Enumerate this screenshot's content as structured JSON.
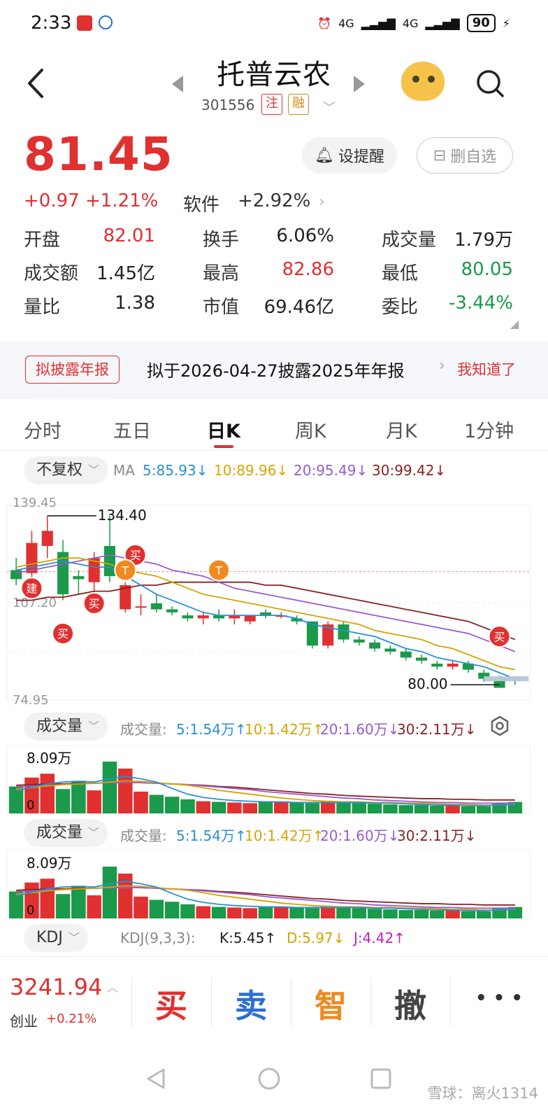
{
  "status": {
    "time": "2:33",
    "net1": "4G",
    "net2": "4G",
    "battery": "90"
  },
  "header": {
    "title": "托普云农",
    "code": "301556",
    "tag1": "注",
    "tag2": "融"
  },
  "quote": {
    "price": "81.45",
    "change": "+0.97",
    "change_pct": "+1.21%",
    "sector": "软件",
    "sector_pct": "+2.92%",
    "alert_btn": "设提醒",
    "del_btn": "删自选",
    "stats": [
      [
        {
          "label": "开盘",
          "value": "82.01",
          "tone": "red"
        },
        {
          "label": "换手",
          "value": "6.06%",
          "tone": "black"
        },
        {
          "label": "成交量",
          "value": "1.79万",
          "tone": "black"
        }
      ],
      [
        {
          "label": "成交额",
          "value": "1.45亿",
          "tone": "black"
        },
        {
          "label": "最高",
          "value": "82.86",
          "tone": "red"
        },
        {
          "label": "最低",
          "value": "80.05",
          "tone": "green"
        }
      ],
      [
        {
          "label": "量比",
          "value": "1.38",
          "tone": "black"
        },
        {
          "label": "市值",
          "value": "69.46亿",
          "tone": "black"
        },
        {
          "label": "委比",
          "value": "-3.44%",
          "tone": "green"
        }
      ]
    ]
  },
  "banner": {
    "badge": "拟披露年报",
    "text": "拟于2026-04-27披露2025年年报",
    "action": "我知道了"
  },
  "tabs": [
    "分时",
    "五日",
    "日K",
    "周K",
    "月K",
    "1分钟"
  ],
  "active_tab": "日K",
  "ma_row": {
    "pill": "不复权",
    "ma_label": "MA",
    "ma5": "5:85.93↓",
    "ma10": "10:89.96↓",
    "ma20": "20:95.49↓",
    "ma30": "30:99.42↓"
  },
  "vol_rows": [
    {
      "pill": "成交量",
      "label": "成交量:",
      "v5": "5:1.54万↑",
      "v10": "10:1.42万↑",
      "v20": "20:1.60万↓",
      "v30": "30:2.11万↓"
    },
    {
      "pill": "成交量",
      "label": "成交量:",
      "v5": "5:1.54万↑",
      "v10": "10:1.42万↑",
      "v20": "20:1.60万↓",
      "v30": "30:2.11万↓"
    }
  ],
  "kdj_row": {
    "pill": "KDJ",
    "label": "KDJ(9,3,3):",
    "k": "K:5.45↑",
    "d": "D:5.97↓",
    "j": "J:4.42↑"
  },
  "chart_data": {
    "type": "candlestick",
    "y_axis_labels": [
      "139.45",
      "107.20",
      "74.95"
    ],
    "high_marker": "134.40",
    "low_marker": "80.00",
    "volume_max_label": "8.09万",
    "volume_zero_label": "0",
    "signals": [
      "买",
      "建",
      "买",
      "买",
      "T",
      "T",
      "买"
    ],
    "candles": [
      {
        "o": 118,
        "h": 122,
        "l": 113,
        "c": 115
      },
      {
        "o": 117,
        "h": 131,
        "l": 112,
        "c": 127
      },
      {
        "o": 126,
        "h": 136,
        "l": 122,
        "c": 131
      },
      {
        "o": 124,
        "h": 128,
        "l": 108,
        "c": 110
      },
      {
        "o": 116,
        "h": 118,
        "l": 110,
        "c": 115
      },
      {
        "o": 114,
        "h": 124,
        "l": 108,
        "c": 122
      },
      {
        "o": 126,
        "h": 136,
        "l": 114,
        "c": 116
      },
      {
        "o": 105,
        "h": 114,
        "l": 104,
        "c": 113
      },
      {
        "o": 106,
        "h": 110,
        "l": 103,
        "c": 106
      },
      {
        "o": 107,
        "h": 110,
        "l": 104,
        "c": 105
      },
      {
        "o": 105,
        "h": 106,
        "l": 103,
        "c": 104
      },
      {
        "o": 103,
        "h": 104,
        "l": 101,
        "c": 102
      },
      {
        "o": 102,
        "h": 104,
        "l": 100,
        "c": 103
      },
      {
        "o": 103,
        "h": 105,
        "l": 101,
        "c": 102
      },
      {
        "o": 102,
        "h": 105,
        "l": 100,
        "c": 103
      },
      {
        "o": 101,
        "h": 103,
        "l": 100,
        "c": 103
      },
      {
        "o": 104,
        "h": 105,
        "l": 102,
        "c": 103
      },
      {
        "o": 103,
        "h": 104,
        "l": 102,
        "c": 103
      },
      {
        "o": 102,
        "h": 103,
        "l": 100,
        "c": 101
      },
      {
        "o": 101,
        "h": 101,
        "l": 92,
        "c": 93
      },
      {
        "o": 93,
        "h": 101,
        "l": 92,
        "c": 100
      },
      {
        "o": 100,
        "h": 101,
        "l": 94,
        "c": 95
      },
      {
        "o": 95,
        "h": 96,
        "l": 93,
        "c": 94
      },
      {
        "o": 94,
        "h": 95,
        "l": 91,
        "c": 92
      },
      {
        "o": 92,
        "h": 93,
        "l": 90,
        "c": 91
      },
      {
        "o": 91,
        "h": 92,
        "l": 88,
        "c": 89
      },
      {
        "o": 89,
        "h": 90,
        "l": 87,
        "c": 88
      },
      {
        "o": 87,
        "h": 88,
        "l": 85,
        "c": 86
      },
      {
        "o": 86,
        "h": 88,
        "l": 85,
        "c": 87
      },
      {
        "o": 87,
        "h": 88,
        "l": 84,
        "c": 85
      },
      {
        "o": 84,
        "h": 85,
        "l": 81,
        "c": 82
      },
      {
        "o": 82,
        "h": 83,
        "l": 79,
        "c": 79
      },
      {
        "o": 82,
        "h": 82.9,
        "l": 80,
        "c": 81.45
      }
    ],
    "ma5": [
      118,
      119,
      120,
      121,
      120,
      119,
      119,
      116,
      113,
      110,
      108,
      106,
      104,
      103,
      103,
      103,
      103,
      103,
      102,
      100,
      99,
      98,
      97,
      96,
      94,
      92,
      91,
      89,
      88,
      87,
      86,
      84,
      82
    ],
    "ma10": [
      119,
      120,
      121,
      122,
      122,
      121,
      120,
      118,
      117,
      116,
      114,
      112,
      110,
      109,
      108,
      107,
      106,
      105,
      104,
      103,
      102,
      101,
      100,
      98,
      97,
      96,
      95,
      93,
      92,
      90,
      88,
      86,
      85
    ],
    "ma20": [
      117,
      118,
      119,
      120,
      121,
      122,
      123,
      122,
      121,
      120,
      118,
      117,
      116,
      114,
      112,
      111,
      110,
      109,
      108,
      107,
      106,
      105,
      104,
      103,
      102,
      101,
      100,
      99,
      98,
      97,
      95,
      93,
      91
    ],
    "ma30": [
      108,
      108,
      109,
      109,
      110,
      111,
      111,
      112,
      113,
      113,
      114,
      114,
      114,
      114,
      114,
      114,
      113,
      113,
      112,
      111,
      110,
      109,
      108,
      107,
      106,
      105,
      104,
      103,
      102,
      101,
      99,
      97,
      95
    ],
    "volumes": [
      4.2,
      5.6,
      6.2,
      3.8,
      5.1,
      3.6,
      8.09,
      7.0,
      3.4,
      2.9,
      2.6,
      2.2,
      1.9,
      1.8,
      1.7,
      1.6,
      1.9,
      1.8,
      1.7,
      1.6,
      1.9,
      1.8,
      1.6,
      1.5,
      1.4,
      1.3,
      1.3,
      1.2,
      1.2,
      1.1,
      1.1,
      1.7,
      1.79
    ],
    "vol_ma5": [
      3.5,
      4.1,
      4.6,
      4.9,
      5.0,
      4.9,
      5.4,
      5.8,
      5.4,
      4.9,
      3.9,
      3.0,
      2.5,
      2.2,
      2.0,
      1.9,
      1.8,
      1.8,
      1.7,
      1.7,
      1.7,
      1.7,
      1.7,
      1.6,
      1.6,
      1.5,
      1.4,
      1.3,
      1.3,
      1.2,
      1.2,
      1.3,
      1.4
    ],
    "vol_ma10": [
      3.8,
      4.0,
      4.3,
      4.5,
      4.6,
      4.7,
      4.9,
      5.1,
      5.0,
      4.8,
      4.6,
      4.4,
      4.0,
      3.6,
      3.3,
      3.0,
      2.7,
      2.4,
      2.2,
      2.0,
      1.9,
      1.8,
      1.8,
      1.7,
      1.7,
      1.6,
      1.6,
      1.5,
      1.4,
      1.4,
      1.3,
      1.3,
      1.4
    ],
    "vol_ma20": [
      4.2,
      4.3,
      4.4,
      4.5,
      4.6,
      4.7,
      4.8,
      4.8,
      4.8,
      4.7,
      4.6,
      4.5,
      4.3,
      4.1,
      3.9,
      3.7,
      3.4,
      3.2,
      3.0,
      2.8,
      2.6,
      2.4,
      2.3,
      2.1,
      2.0,
      1.9,
      1.8,
      1.7,
      1.7,
      1.6,
      1.6,
      1.6,
      1.6
    ],
    "vol_ma30": [
      4.4,
      4.5,
      4.6,
      4.6,
      4.7,
      4.7,
      4.8,
      4.8,
      4.8,
      4.7,
      4.6,
      4.5,
      4.4,
      4.2,
      4.1,
      3.9,
      3.7,
      3.5,
      3.3,
      3.1,
      3.0,
      2.8,
      2.7,
      2.6,
      2.5,
      2.4,
      2.3,
      2.3,
      2.2,
      2.2,
      2.1,
      2.1,
      2.1
    ],
    "colors": {
      "up": "#e03030",
      "down": "#1a9a4a",
      "ma5": "#2a8fd6",
      "ma10": "#d7a400",
      "ma20": "#9a5ad0",
      "ma30": "#8a2222",
      "signal": "#e03030",
      "t_signal": "#f08a20"
    }
  },
  "bottom": {
    "index_value": "3241.94",
    "index_name": "创业",
    "index_change": "+0.21%",
    "buy": "买",
    "sell": "卖",
    "smart": "智",
    "cancel": "撤",
    "more": "• • •"
  },
  "watermark": "雪球：离火1314"
}
